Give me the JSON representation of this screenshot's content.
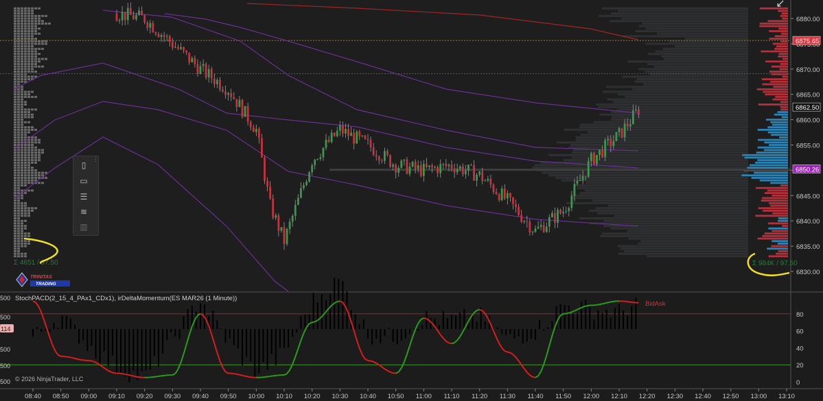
{
  "price_axis": {
    "ticks": [
      "6880.00",
      "6875.00",
      "6870.00",
      "6865.00",
      "6860.00",
      "6855.00",
      "6850.00",
      "6845.00",
      "6840.00",
      "6835.00",
      "6830.00"
    ],
    "markers": [
      {
        "label": "6875.65",
        "color": "#e0323c"
      },
      {
        "label": "6862.50",
        "color": "#111111"
      },
      {
        "label": "6850.26",
        "color": "#a020c0"
      }
    ]
  },
  "time_axis": {
    "ticks": [
      "08:40",
      "08:50",
      "09:00",
      "09:10",
      "09:20",
      "09:30",
      "09:40",
      "09:50",
      "10:00",
      "10:10",
      "10:20",
      "10:30",
      "10:40",
      "10:50",
      "11:00",
      "11:10",
      "11:20",
      "11:30",
      "11:40",
      "11:50",
      "12:00",
      "12:10",
      "12:20",
      "12:30",
      "12:40",
      "12:50",
      "13:00",
      "13:10"
    ]
  },
  "left_profile_label": "Σ 4651 / 97.50",
  "right_profile_label": "Σ 984K / 97.50",
  "indicator": {
    "title": "StochPACD(2_15_4_PAx1_CDx1), irDeltaMomentum(ES MAR26 (1 Minute))",
    "tag": "BidAsk",
    "right_ticks": [
      "80",
      "60",
      "40",
      "20",
      "0"
    ],
    "left_ticks": [
      "500",
      "500",
      "114",
      "500",
      "500",
      "500"
    ]
  },
  "copyright": "© 2026 NinjaTrader, LLC",
  "logo": {
    "line1": "TRINITAS",
    "line2": "TRADING"
  },
  "toolbar": {
    "icons": [
      "rectangle-tool-icon",
      "select-tool-icon",
      "volume-profile-icon",
      "wave-icon",
      "bars-icon"
    ]
  },
  "colors": {
    "up": "#3a9a4a",
    "down": "#c8323c",
    "vwap": "#7a2fa8",
    "stoch": "#d81e1e",
    "stoch_green": "#2a9d1a"
  },
  "chart_data": {
    "type": "candlestick",
    "instrument": "ES MAR26 (1 Minute)",
    "price_range": [
      6828,
      6882
    ],
    "time_range": [
      "08:40",
      "13:10"
    ],
    "close_series": {
      "times": [
        "09:10",
        "09:20",
        "09:30",
        "09:40",
        "09:50",
        "10:00",
        "10:05",
        "10:10",
        "10:20",
        "10:30",
        "10:40",
        "10:50",
        "11:00",
        "11:10",
        "11:20",
        "11:30",
        "11:40",
        "11:50",
        "12:00",
        "12:10",
        "12:17"
      ],
      "values": [
        6881,
        6880,
        6875,
        6870,
        6866,
        6858,
        6843,
        6836,
        6852,
        6858,
        6855,
        6851,
        6850,
        6851,
        6849,
        6844,
        6838,
        6842,
        6852,
        6857,
        6862
      ]
    },
    "key_levels": [
      {
        "label": "6875.65",
        "price": 6875.65
      },
      {
        "label": "6862.50",
        "price": 6862.5
      },
      {
        "label": "6850.26",
        "price": 6850.26
      }
    ],
    "indicator": {
      "ylim": [
        0,
        100
      ],
      "levels": [
        80,
        20
      ],
      "stoch": {
        "times": [
          "08:40",
          "08:50",
          "09:00",
          "09:10",
          "09:20",
          "09:30",
          "09:40",
          "09:50",
          "10:00",
          "10:10",
          "10:20",
          "10:30",
          "10:40",
          "10:50",
          "11:00",
          "11:10",
          "11:20",
          "11:30",
          "11:40",
          "11:50",
          "12:00",
          "12:10",
          "12:17"
        ],
        "values": [
          95,
          30,
          25,
          10,
          5,
          8,
          80,
          10,
          5,
          8,
          70,
          95,
          25,
          10,
          75,
          45,
          85,
          35,
          5,
          80,
          90,
          95,
          93
        ]
      },
      "delta_histogram": {
        "times": [
          "08:40",
          "08:50",
          "09:00",
          "09:10",
          "09:20",
          "09:30",
          "09:40",
          "09:50",
          "10:00",
          "10:10",
          "10:20",
          "10:30",
          "10:40",
          "10:50",
          "11:00",
          "11:10",
          "11:20",
          "11:30",
          "11:40",
          "11:50",
          "12:00",
          "12:10",
          "12:17"
        ],
        "values": [
          -8,
          12,
          -15,
          -35,
          -45,
          -10,
          28,
          -12,
          -40,
          -22,
          25,
          45,
          -5,
          -8,
          10,
          8,
          12,
          -10,
          -2,
          22,
          18,
          15,
          25
        ]
      }
    }
  }
}
